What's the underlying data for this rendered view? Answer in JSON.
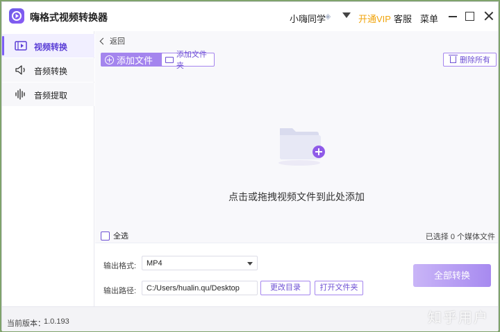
{
  "app": {
    "title": "嗨格式视频转换器"
  },
  "header": {
    "user_name": "小嗨同学",
    "vip_label": "开通VIP",
    "service_label": "客服",
    "menu_label": "菜单"
  },
  "sidebar": {
    "items": [
      {
        "label": "视频转换",
        "icon": "video-convert-icon",
        "active": true
      },
      {
        "label": "音频转换",
        "icon": "speaker-icon",
        "active": false
      },
      {
        "label": "音频提取",
        "icon": "waveform-icon",
        "active": false
      }
    ]
  },
  "toolbar": {
    "back_label": "返回",
    "add_file_label": "添加文件",
    "add_folder_label": "添加文件夹",
    "delete_all_label": "删除所有"
  },
  "drop_zone": {
    "hint": "点击或拖拽视频文件到此处添加"
  },
  "list_footer": {
    "select_all_label": "全选",
    "selected_count_text": "已选择 0 个媒体文件"
  },
  "output": {
    "format_label": "输出格式:",
    "format_value": "MP4",
    "path_label": "输出路径:",
    "path_value": "C:/Users/hualin.qu/Desktop",
    "change_dir_label": "更改目录",
    "open_folder_label": "打开文件夹",
    "convert_all_label": "全部转换"
  },
  "status": {
    "version_label": "当前版本：",
    "version_value": "1.0.193"
  },
  "watermark": "知乎用户",
  "colors": {
    "accent": "#7b5cf5",
    "vip": "#f0a30a"
  }
}
